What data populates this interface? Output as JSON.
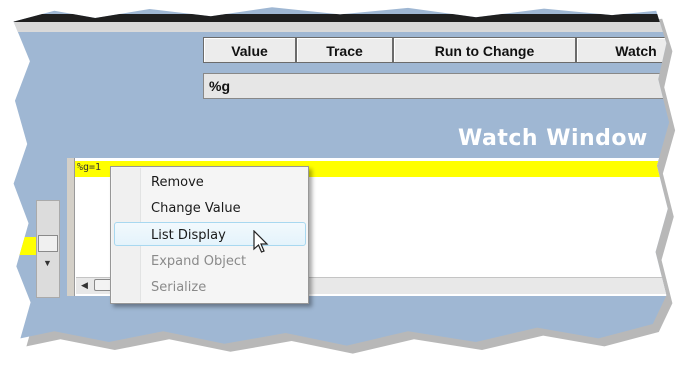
{
  "toolbar": {
    "buttons": [
      "Value",
      "Trace",
      "Run to Change",
      "Watch"
    ]
  },
  "expression": {
    "value": "%g"
  },
  "window_title": "Watch Window",
  "watch_list": {
    "rows": [
      "%g=1"
    ]
  },
  "context_menu": {
    "items": [
      {
        "label": "Remove",
        "enabled": true
      },
      {
        "label": "Change Value",
        "enabled": true
      },
      {
        "label": "List Display",
        "enabled": true,
        "hovered": true
      },
      {
        "label": "Expand Object",
        "enabled": false
      },
      {
        "label": "Serialize",
        "enabled": false
      }
    ]
  },
  "colors": {
    "panel_background": "#9fb7d3",
    "highlight_row": "#ffff00",
    "title_text": "#ffffff"
  }
}
